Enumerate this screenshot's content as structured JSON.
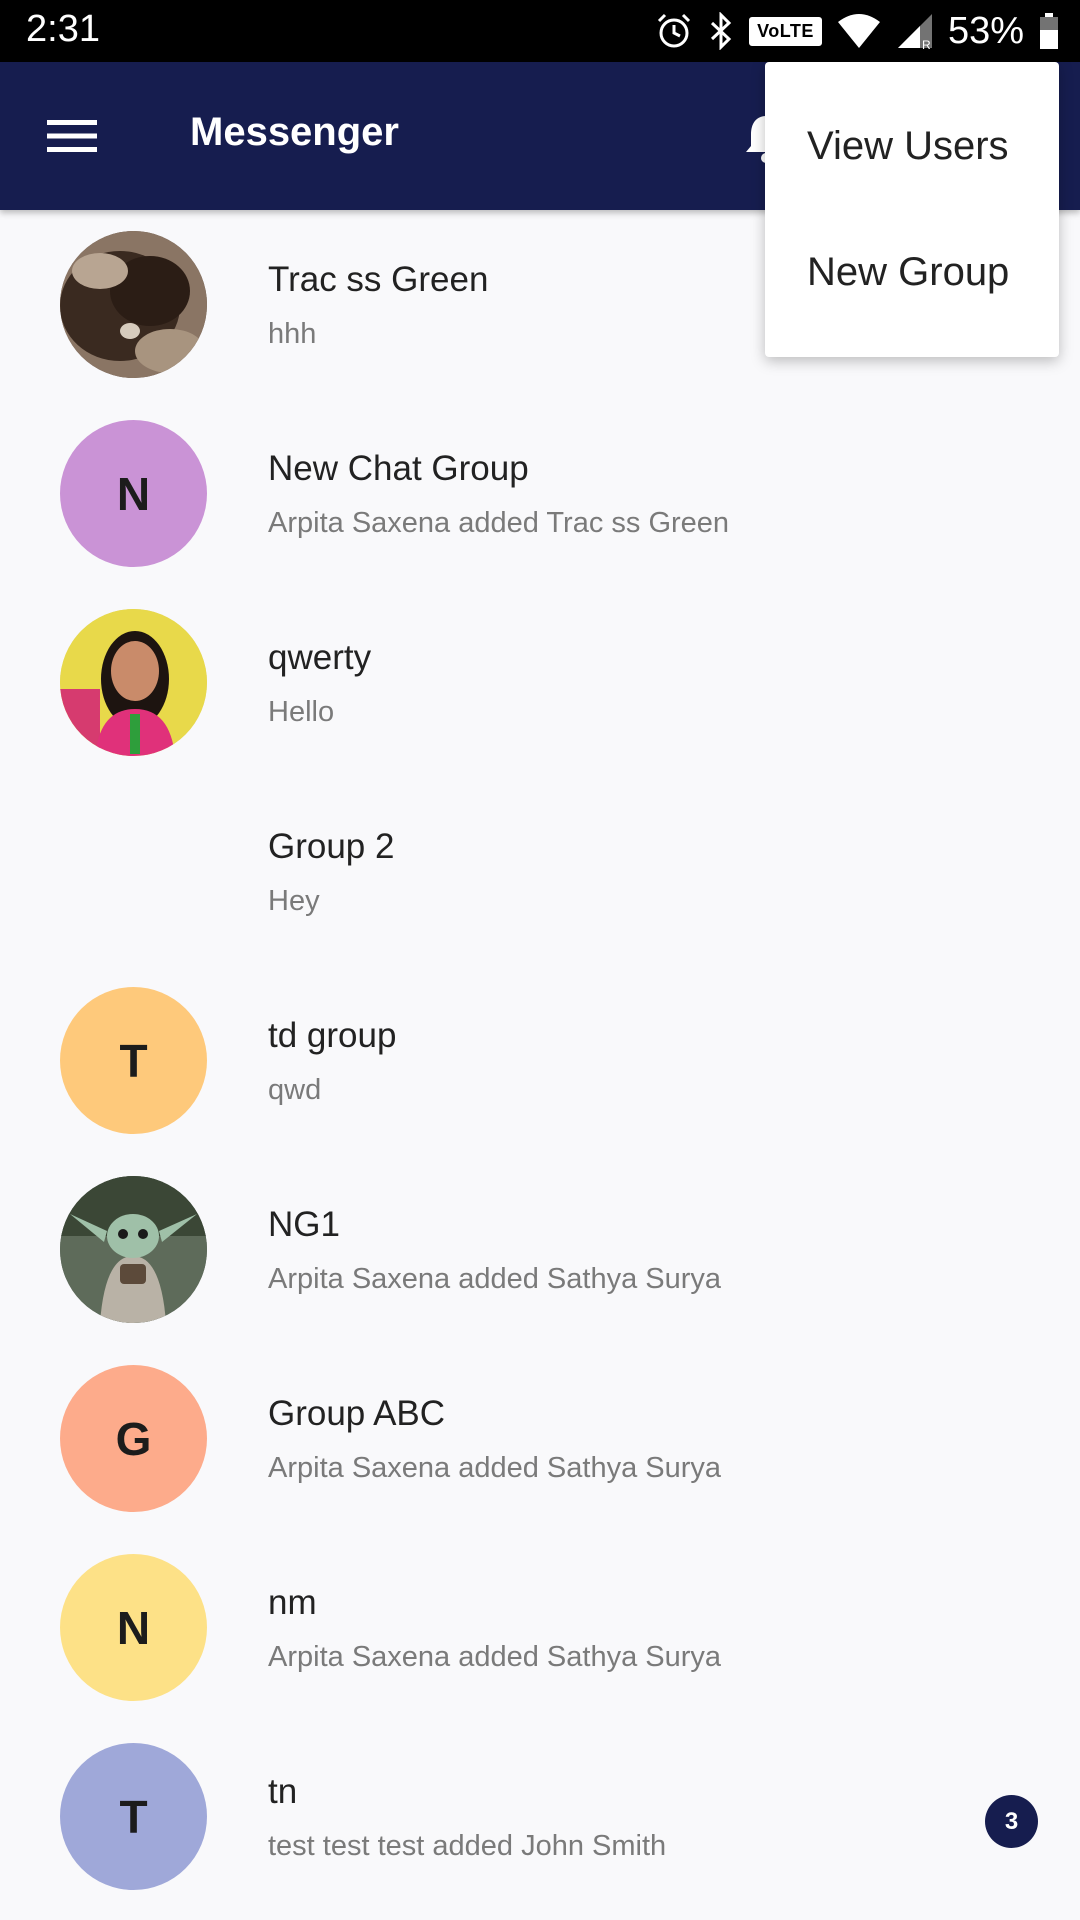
{
  "status_bar": {
    "time": "2:31",
    "volte": "VoLTE",
    "battery": "53%",
    "icons": [
      "alarm-icon",
      "bluetooth-icon",
      "wifi-icon",
      "signal-icon",
      "battery-icon"
    ]
  },
  "app_bar": {
    "title": "Messenger",
    "color": "#161d4f"
  },
  "menu": {
    "items": [
      {
        "label": "View Users"
      },
      {
        "label": "New Group"
      }
    ]
  },
  "chats": [
    {
      "name": "Trac ss Green",
      "message": "hhh",
      "avatar_type": "photo",
      "avatar_desc": "dirt-photo"
    },
    {
      "name": "New Chat Group",
      "message": "Arpita  Saxena added Trac ss Green",
      "avatar_type": "letter",
      "letter": "N",
      "color": "#ca93d6"
    },
    {
      "name": "qwerty",
      "message": "Hello",
      "avatar_type": "photo",
      "avatar_desc": "person-photo"
    },
    {
      "name": "Group 2",
      "message": "Hey",
      "avatar_type": "none"
    },
    {
      "name": "td group",
      "message": "qwd",
      "avatar_type": "letter",
      "letter": "T",
      "color": "#fec97b"
    },
    {
      "name": "NG1",
      "message": "Arpita  Saxena added Sathya  Surya",
      "avatar_type": "photo",
      "avatar_desc": "baby-yoda-photo"
    },
    {
      "name": "Group ABC",
      "message": "Arpita  Saxena added Sathya  Surya",
      "avatar_type": "letter",
      "letter": "G",
      "color": "#fdab8b"
    },
    {
      "name": "nm",
      "message": "Arpita  Saxena added Sathya  Surya",
      "avatar_type": "letter",
      "letter": "N",
      "color": "#fde187"
    },
    {
      "name": "tn",
      "message": "test test test added John  Smith",
      "avatar_type": "letter",
      "letter": "T",
      "color": "#9fa8d9",
      "unread": "3"
    }
  ]
}
